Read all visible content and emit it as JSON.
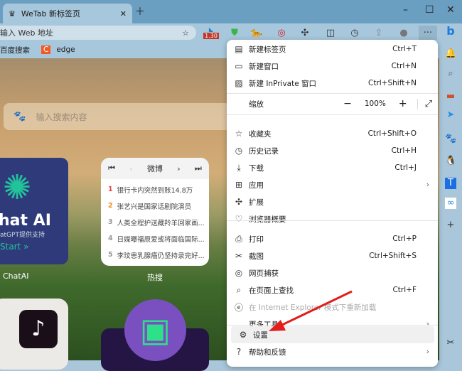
{
  "tab": {
    "title": "WeTab 新标签页"
  },
  "address": {
    "placeholder": "输入 Web 地址"
  },
  "toolbar": {
    "badge": "1.30"
  },
  "bookmarks": [
    {
      "label": "百度搜索"
    },
    {
      "label": "edge"
    }
  ],
  "search": {
    "placeholder": "输入搜索内容"
  },
  "chatai": {
    "title": "hat AI",
    "subtitle": "atGPT提供支持",
    "start": "Start »",
    "label": "ChatAI"
  },
  "hot": {
    "source": "微博",
    "label": "热搜",
    "items": [
      {
        "rank": "1",
        "text": "银行卡内突然到账14.8万",
        "color": "#f04040"
      },
      {
        "rank": "2",
        "text": "张艺兴是国家话剧院演员",
        "color": "#f08a20"
      },
      {
        "rank": "3",
        "text": "人类全程护送藏羚羊回家画...",
        "color": "#999"
      },
      {
        "rank": "4",
        "text": "日媒曝福原爱或将面临国际...",
        "color": "#999"
      },
      {
        "rank": "5",
        "text": "李玟患乳腺癌仍坚持录完好...",
        "color": "#999"
      }
    ]
  },
  "menu": {
    "zoom_label": "缩放",
    "zoom_value": "100%",
    "items": [
      {
        "icon": "new-tab-icon",
        "glyph": "▤",
        "label": "新建标签页",
        "shortcut": "Ctrl+T"
      },
      {
        "icon": "new-window-icon",
        "glyph": "▭",
        "label": "新建窗口",
        "shortcut": "Ctrl+N"
      },
      {
        "icon": "inprivate-icon",
        "glyph": "▨",
        "label": "新建 InPrivate 窗口",
        "shortcut": "Ctrl+Shift+N"
      },
      {
        "icon": "favorites-icon",
        "glyph": "☆",
        "label": "收藏夹",
        "shortcut": "Ctrl+Shift+O"
      },
      {
        "icon": "history-icon",
        "glyph": "◷",
        "label": "历史记录",
        "shortcut": "Ctrl+H"
      },
      {
        "icon": "download-icon",
        "glyph": "⤓",
        "label": "下载",
        "shortcut": "Ctrl+J"
      },
      {
        "icon": "apps-icon",
        "glyph": "⊞",
        "label": "应用",
        "shortcut": "",
        "sub": true
      },
      {
        "icon": "extensions-icon",
        "glyph": "✣",
        "label": "扩展",
        "shortcut": ""
      },
      {
        "icon": "browser-essentials-icon",
        "glyph": "♡",
        "label": "浏览器概要",
        "shortcut": ""
      },
      {
        "icon": "print-icon",
        "glyph": "⎙",
        "label": "打印",
        "shortcut": "Ctrl+P"
      },
      {
        "icon": "screenshot-icon",
        "glyph": "✂",
        "label": "截图",
        "shortcut": "Ctrl+Shift+S"
      },
      {
        "icon": "web-capture-icon",
        "glyph": "◎",
        "label": "网页捕获",
        "shortcut": ""
      },
      {
        "icon": "find-icon",
        "glyph": "⌕",
        "label": "在页面上查找",
        "shortcut": "Ctrl+F"
      },
      {
        "icon": "ie-mode-icon",
        "glyph": "ⓔ",
        "label": "在 Internet Explorer 模式下重新加载",
        "shortcut": "",
        "disabled": true
      },
      {
        "icon": "",
        "glyph": "",
        "label": "更多工具",
        "shortcut": "",
        "sub": true
      },
      {
        "icon": "settings-icon",
        "glyph": "⚙",
        "label": "设置",
        "shortcut": "",
        "hl": true
      },
      {
        "icon": "help-icon",
        "glyph": "?",
        "label": "帮助和反馈",
        "shortcut": "",
        "sub": true
      }
    ]
  }
}
